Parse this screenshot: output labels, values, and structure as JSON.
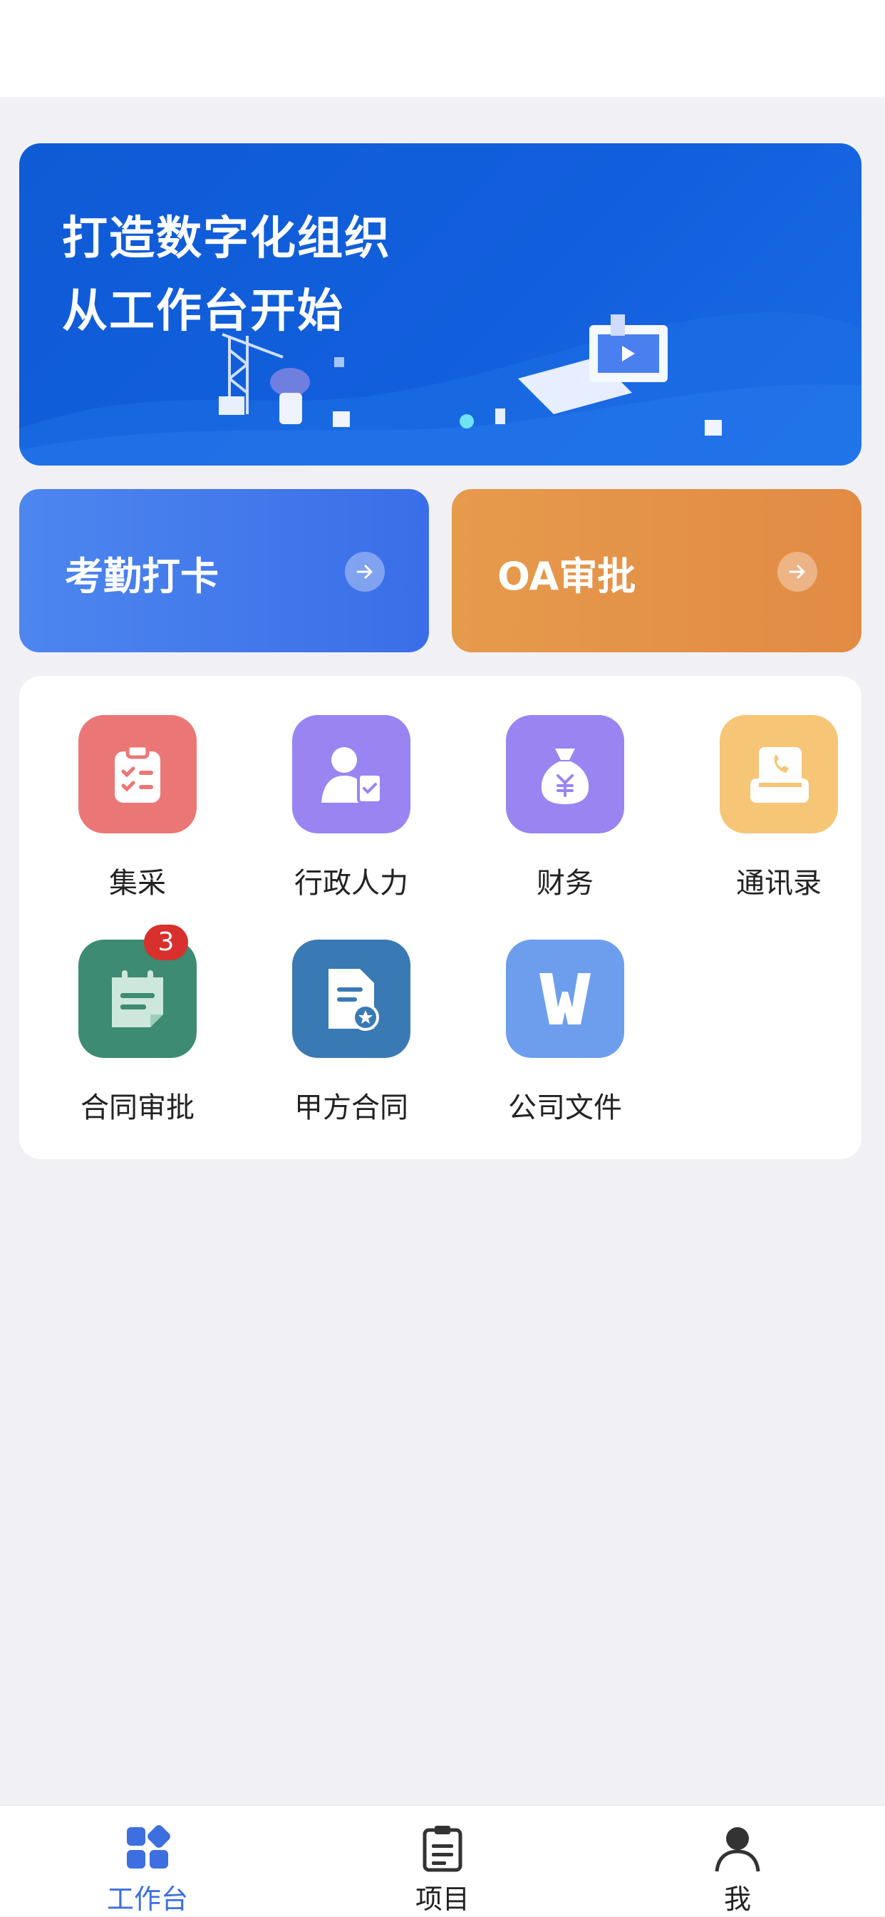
{
  "banner": {
    "line1": "打造数字化组织",
    "line2": "从工作台开始"
  },
  "quick_actions": [
    {
      "label": "考勤打卡",
      "color": "#4a80ee"
    },
    {
      "label": "OA审批",
      "color": "#e4934a"
    }
  ],
  "apps": [
    {
      "label": "集采",
      "icon": "clipboard-check-icon",
      "color": "#ea7776"
    },
    {
      "label": "行政人力",
      "icon": "person-document-icon",
      "color": "#9a84f2"
    },
    {
      "label": "财务",
      "icon": "money-bag-icon",
      "color": "#9a84f2"
    },
    {
      "label": "通讯录",
      "icon": "contacts-phone-icon",
      "color": "#f6c575"
    },
    {
      "label": "合同审批",
      "icon": "notepad-icon",
      "color": "#3c8b72",
      "badge": "3"
    },
    {
      "label": "甲方合同",
      "icon": "document-star-icon",
      "color": "#3a7ab4"
    },
    {
      "label": "公司文件",
      "icon": "word-file-icon",
      "color": "#6d9eee"
    }
  ],
  "tabbar": {
    "items": [
      {
        "label": "工作台",
        "icon": "workbench-grid-icon",
        "active": true
      },
      {
        "label": "项目",
        "icon": "clipboard-list-icon",
        "active": false
      },
      {
        "label": "我",
        "icon": "user-profile-icon",
        "active": false
      }
    ],
    "active_color": "#3d6fe0"
  }
}
